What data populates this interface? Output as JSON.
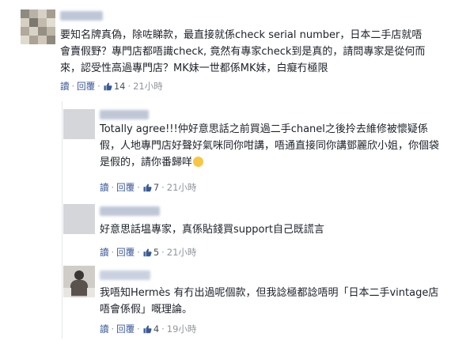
{
  "comments": [
    {
      "body": "要知名牌真偽，除咗睇款，最直接就係check serial number，日本二手店就唔會賣假野？專門店都唔識check, 竟然有專家check到是真的，請問專家是從何而來，認受性高過專門店？MK妹一世都係MK妹，白癡冇極限",
      "reply_label": "讀",
      "respond_label": "回覆",
      "likes": "14",
      "time": "21小時"
    },
    {
      "body": "Totally agree!!!仲好意思話之前買過二手chanel之後拎去維修被懷疑係假，人地專門店好聲好氣咪同你咁講，唔通直接同你講鄧麗欣小姐，你個袋是假的，請你番歸咩",
      "reply_label": "讀",
      "respond_label": "回覆",
      "likes": "7",
      "time": "21小時"
    },
    {
      "body": "好意思話塭專家，真係貼錢買support自己既謊言",
      "reply_label": "讀",
      "respond_label": "回覆",
      "likes": "5",
      "time": "21小時"
    },
    {
      "body": "我唔知Hermès 有冇出過呢個款，但我諗極都諗唔明「日本二手vintage店唔會係假」嘅理論。",
      "reply_label": "讀",
      "respond_label": "回覆",
      "likes": "4",
      "time": "19小時"
    }
  ],
  "colors": {
    "link": "#385898",
    "text": "#1d2129",
    "meta": "#90949c"
  }
}
